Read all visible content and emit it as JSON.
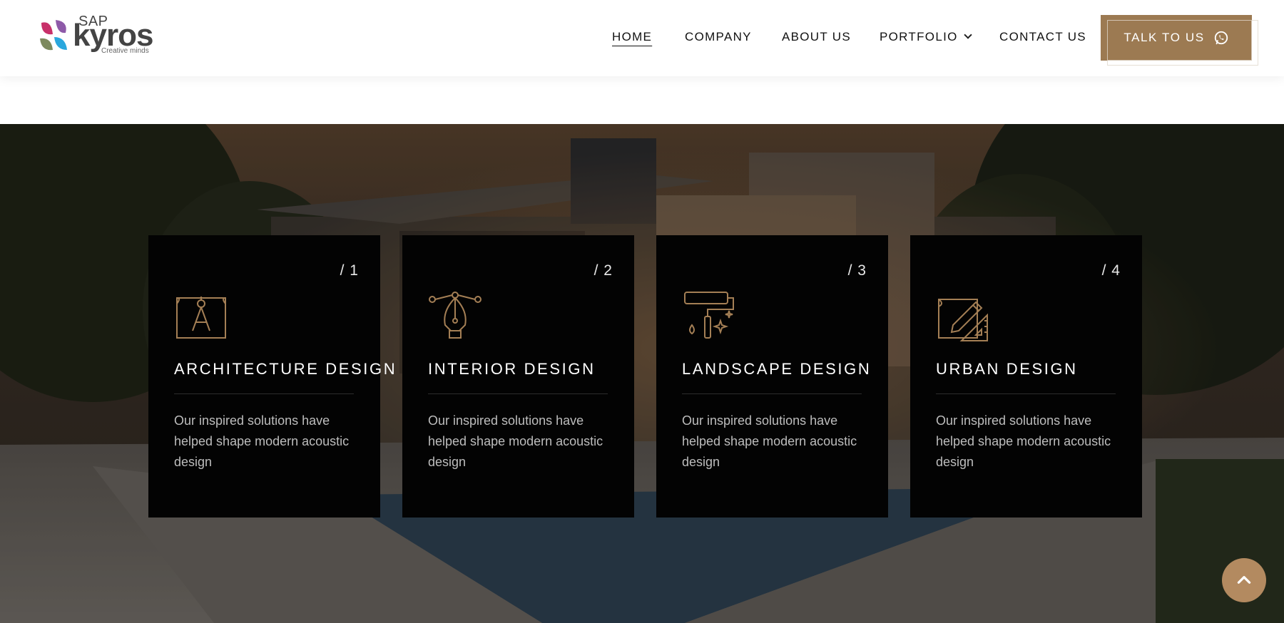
{
  "brand": {
    "sap": "SAP",
    "name": "kyros",
    "tagline": "Creative minds"
  },
  "nav": {
    "items": [
      {
        "label": "HOME"
      },
      {
        "label": "COMPANY"
      },
      {
        "label": "ABOUT US"
      },
      {
        "label": "PORTFOLIO"
      },
      {
        "label": "CONTACT US"
      }
    ],
    "active": "HOME",
    "cta_label": "TALK TO US"
  },
  "services": [
    {
      "number": "/ 1",
      "title": "ARCHITECTURE DESIGN",
      "text": "Our inspired solutions have helped shape modern acoustic design",
      "icon": "blueprint-compass-icon"
    },
    {
      "number": "/ 2",
      "title": "INTERIOR DESIGN",
      "text": "Our inspired solutions have helped shape modern acoustic design",
      "icon": "pen-tool-icon"
    },
    {
      "number": "/ 3",
      "title": "LANDSCAPE DESIGN",
      "text": "Our inspired solutions have helped shape modern acoustic design",
      "icon": "paint-roller-icon"
    },
    {
      "number": "/ 4",
      "title": "URBAN DESIGN",
      "text": "Our inspired solutions have helped shape modern acoustic design",
      "icon": "plan-pencil-ruler-icon"
    }
  ],
  "colors": {
    "accent": "#9c7a52",
    "icon_stroke": "#a47f55",
    "card_bg": "#030303",
    "scroll_top": "#b38a60"
  },
  "icons": {
    "cta": "whatsapp-icon",
    "scroll_top": "chevron-up-icon",
    "portfolio": "chevron-down-icon"
  }
}
